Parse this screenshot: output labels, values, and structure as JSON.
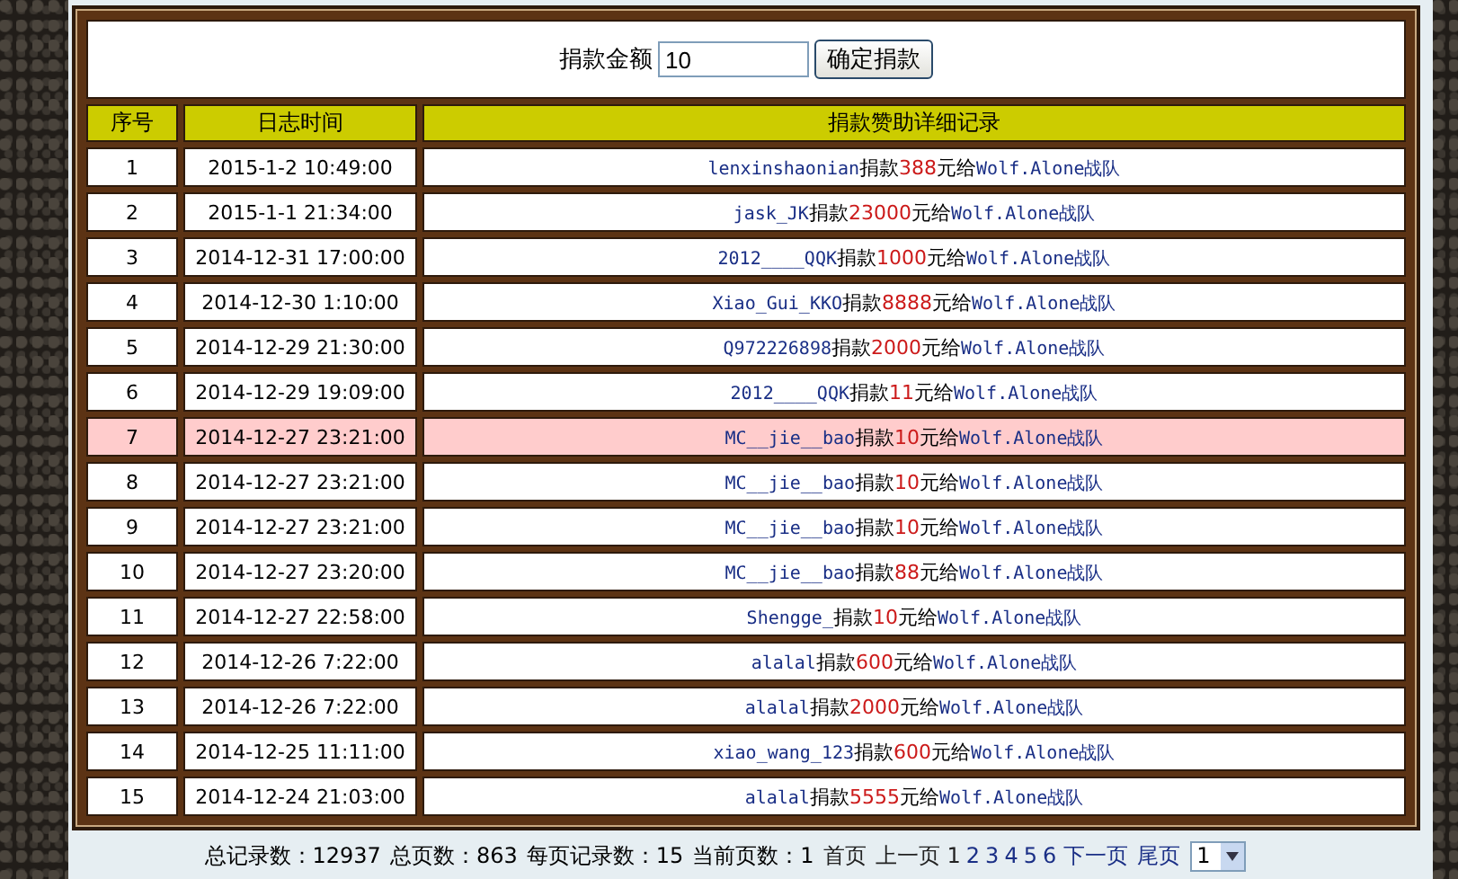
{
  "donate_form": {
    "label": "捐款金额",
    "amount": "10",
    "button": "确定捐款"
  },
  "table": {
    "columns": [
      "序号",
      "日志时间",
      "捐款赞助详细记录"
    ],
    "rows": [
      {
        "no": "1",
        "time": "2015-1-2 10:49:00",
        "user": "lenxinshaonian",
        "verb": "捐款",
        "amount": "388",
        "unit": "元给",
        "team": "Wolf.Alone战队",
        "selected": false
      },
      {
        "no": "2",
        "time": "2015-1-1 21:34:00",
        "user": "jask_JK",
        "verb": "捐款",
        "amount": "23000",
        "unit": "元给",
        "team": "Wolf.Alone战队",
        "selected": false
      },
      {
        "no": "3",
        "time": "2014-12-31 17:00:00",
        "user": "2012____QQK",
        "verb": "捐款",
        "amount": "1000",
        "unit": "元给",
        "team": "Wolf.Alone战队",
        "selected": false
      },
      {
        "no": "4",
        "time": "2014-12-30 1:10:00",
        "user": "Xiao_Gui_KKO",
        "verb": "捐款",
        "amount": "8888",
        "unit": "元给",
        "team": "Wolf.Alone战队",
        "selected": false
      },
      {
        "no": "5",
        "time": "2014-12-29 21:30:00",
        "user": "Q972226898",
        "verb": "捐款",
        "amount": "2000",
        "unit": "元给",
        "team": "Wolf.Alone战队",
        "selected": false
      },
      {
        "no": "6",
        "time": "2014-12-29 19:09:00",
        "user": "2012____QQK",
        "verb": "捐款",
        "amount": "11",
        "unit": "元给",
        "team": "Wolf.Alone战队",
        "selected": false
      },
      {
        "no": "7",
        "time": "2014-12-27 23:21:00",
        "user": "MC__jie__bao",
        "verb": "捐款",
        "amount": "10",
        "unit": "元给",
        "team": "Wolf.Alone战队",
        "selected": true
      },
      {
        "no": "8",
        "time": "2014-12-27 23:21:00",
        "user": "MC__jie__bao",
        "verb": "捐款",
        "amount": "10",
        "unit": "元给",
        "team": "Wolf.Alone战队",
        "selected": false
      },
      {
        "no": "9",
        "time": "2014-12-27 23:21:00",
        "user": "MC__jie__bao",
        "verb": "捐款",
        "amount": "10",
        "unit": "元给",
        "team": "Wolf.Alone战队",
        "selected": false
      },
      {
        "no": "10",
        "time": "2014-12-27 23:20:00",
        "user": "MC__jie__bao",
        "verb": "捐款",
        "amount": "88",
        "unit": "元给",
        "team": "Wolf.Alone战队",
        "selected": false
      },
      {
        "no": "11",
        "time": "2014-12-27 22:58:00",
        "user": "Shengge_",
        "verb": "捐款",
        "amount": "10",
        "unit": "元给",
        "team": "Wolf.Alone战队",
        "selected": false
      },
      {
        "no": "12",
        "time": "2014-12-26 7:22:00",
        "user": "alalal",
        "verb": "捐款",
        "amount": "600",
        "unit": "元给",
        "team": "Wolf.Alone战队",
        "selected": false
      },
      {
        "no": "13",
        "time": "2014-12-26 7:22:00",
        "user": "alalal",
        "verb": "捐款",
        "amount": "2000",
        "unit": "元给",
        "team": "Wolf.Alone战队",
        "selected": false
      },
      {
        "no": "14",
        "time": "2014-12-25 11:11:00",
        "user": "xiao_wang_123",
        "verb": "捐款",
        "amount": "600",
        "unit": "元给",
        "team": "Wolf.Alone战队",
        "selected": false
      },
      {
        "no": "15",
        "time": "2014-12-24 21:03:00",
        "user": "alalal",
        "verb": "捐款",
        "amount": "5555",
        "unit": "元给",
        "team": "Wolf.Alone战队",
        "selected": false
      }
    ]
  },
  "pager": {
    "stats": [
      "总记录数：12937",
      "总页数：863",
      "每页记录数：15",
      "当前页数：1"
    ],
    "nav_before": [
      {
        "label": "首页",
        "disabled": true
      },
      {
        "label": "上一页",
        "disabled": true
      }
    ],
    "pages": [
      {
        "label": "1",
        "selected": true
      },
      {
        "label": "2",
        "selected": false
      },
      {
        "label": "3",
        "selected": false
      },
      {
        "label": "4",
        "selected": false
      },
      {
        "label": "5",
        "selected": false
      },
      {
        "label": "6",
        "selected": false
      }
    ],
    "nav_after": [
      {
        "label": "下一页",
        "disabled": false
      },
      {
        "label": "尾页",
        "disabled": false
      }
    ],
    "page_select": "1"
  }
}
